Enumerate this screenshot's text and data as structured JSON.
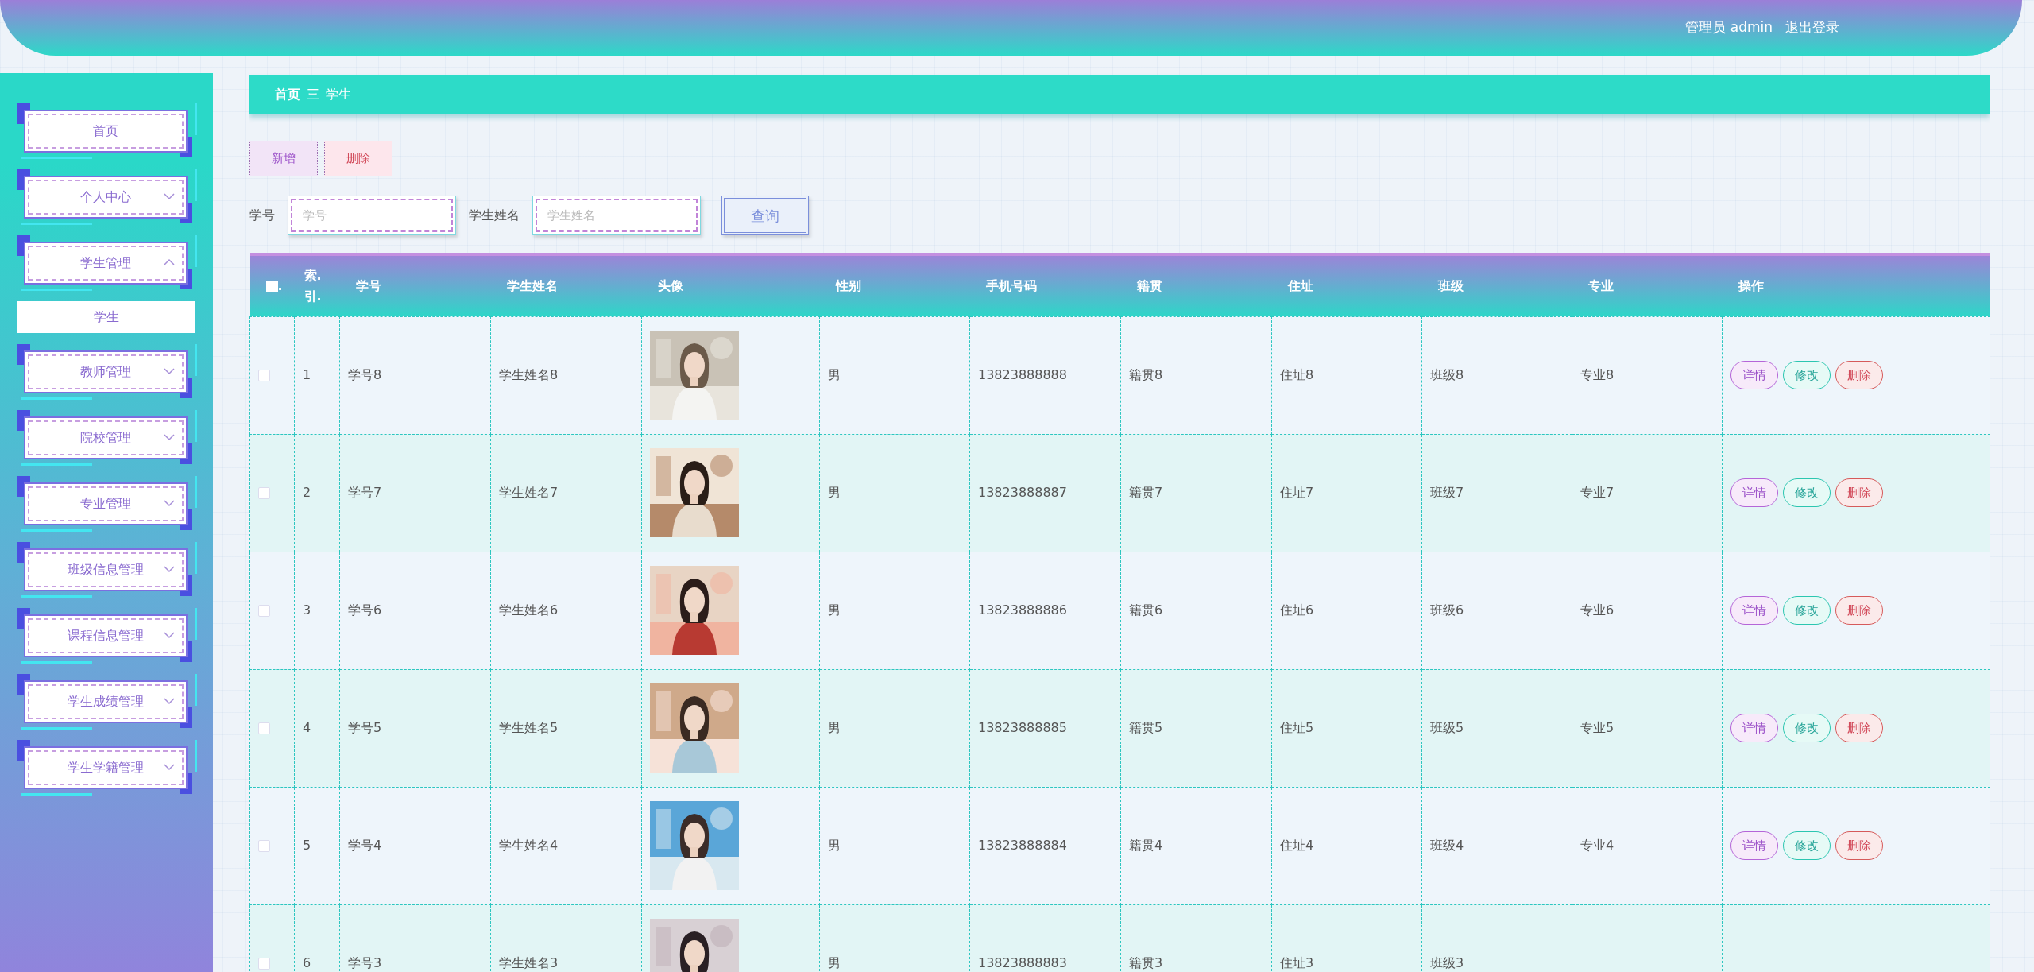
{
  "header": {
    "user": "管理员 admin",
    "logout": "退出登录"
  },
  "sidebar": {
    "items": [
      {
        "label": "首页",
        "kind": "link"
      },
      {
        "label": "个人中心",
        "kind": "group",
        "expanded": false
      },
      {
        "label": "学生管理",
        "kind": "group",
        "expanded": true,
        "children": [
          {
            "label": "学生",
            "selected": true
          }
        ]
      },
      {
        "label": "教师管理",
        "kind": "group",
        "expanded": false
      },
      {
        "label": "院校管理",
        "kind": "group",
        "expanded": false
      },
      {
        "label": "专业管理",
        "kind": "group",
        "expanded": false
      },
      {
        "label": "班级信息管理",
        "kind": "group",
        "expanded": false
      },
      {
        "label": "课程信息管理",
        "kind": "group",
        "expanded": false
      },
      {
        "label": "学生成绩管理",
        "kind": "group",
        "expanded": false
      },
      {
        "label": "学生学籍管理",
        "kind": "group",
        "expanded": false
      }
    ]
  },
  "breadcrumb": {
    "home": "首页",
    "separator": "三",
    "current": "学生"
  },
  "actions": [
    {
      "label": "新增",
      "kind": "add"
    },
    {
      "label": "删除",
      "kind": "delete"
    }
  ],
  "search": {
    "fields": [
      {
        "label": "学号",
        "placeholder": "学号"
      },
      {
        "label": "学生姓名",
        "placeholder": "学生姓名"
      }
    ],
    "button": "查询"
  },
  "table": {
    "select_all": {
      "checked": false,
      "mark": "."
    },
    "columns": [
      "索.引.",
      "学号",
      "学生姓名",
      "头像",
      "性别",
      "手机号码",
      "籍贯",
      "住址",
      "班级",
      "专业",
      "操作"
    ],
    "rows": [
      {
        "checked": false,
        "index": "1",
        "student_no": "学号8",
        "name": "学生姓名8",
        "gender": "男",
        "phone": "13823888888",
        "origin": "籍贯8",
        "address": "住址8",
        "class": "班级8",
        "major": "专业8",
        "buttons": [
          {
            "label": "详情",
            "kind": "detail"
          },
          {
            "label": "修改",
            "kind": "edit"
          },
          {
            "label": "删除",
            "kind": "delete"
          }
        ]
      },
      {
        "checked": false,
        "index": "2",
        "student_no": "学号7",
        "name": "学生姓名7",
        "gender": "男",
        "phone": "13823888887",
        "origin": "籍贯7",
        "address": "住址7",
        "class": "班级7",
        "major": "专业7",
        "buttons": [
          {
            "label": "详情",
            "kind": "detail"
          },
          {
            "label": "修改",
            "kind": "edit"
          },
          {
            "label": "删除",
            "kind": "delete"
          }
        ]
      },
      {
        "checked": false,
        "index": "3",
        "student_no": "学号6",
        "name": "学生姓名6",
        "gender": "男",
        "phone": "13823888886",
        "origin": "籍贯6",
        "address": "住址6",
        "class": "班级6",
        "major": "专业6",
        "buttons": [
          {
            "label": "详情",
            "kind": "detail"
          },
          {
            "label": "修改",
            "kind": "edit"
          },
          {
            "label": "删除",
            "kind": "delete"
          }
        ]
      },
      {
        "checked": false,
        "index": "4",
        "student_no": "学号5",
        "name": "学生姓名5",
        "gender": "男",
        "phone": "13823888885",
        "origin": "籍贯5",
        "address": "住址5",
        "class": "班级5",
        "major": "专业5",
        "buttons": [
          {
            "label": "详情",
            "kind": "detail"
          },
          {
            "label": "修改",
            "kind": "edit"
          },
          {
            "label": "删除",
            "kind": "delete"
          }
        ]
      },
      {
        "checked": false,
        "index": "5",
        "student_no": "学号4",
        "name": "学生姓名4",
        "gender": "男",
        "phone": "13823888884",
        "origin": "籍贯4",
        "address": "住址4",
        "class": "班级4",
        "major": "专业4",
        "buttons": [
          {
            "label": "详情",
            "kind": "detail"
          },
          {
            "label": "修改",
            "kind": "edit"
          },
          {
            "label": "删除",
            "kind": "delete"
          }
        ]
      },
      {
        "checked": false,
        "index": "6",
        "student_no": "学号3",
        "name": "学生姓名3",
        "gender": "男",
        "phone": "13823888883",
        "origin": "籍贯3",
        "address": "住址3",
        "class": "班级3"
      }
    ]
  }
}
